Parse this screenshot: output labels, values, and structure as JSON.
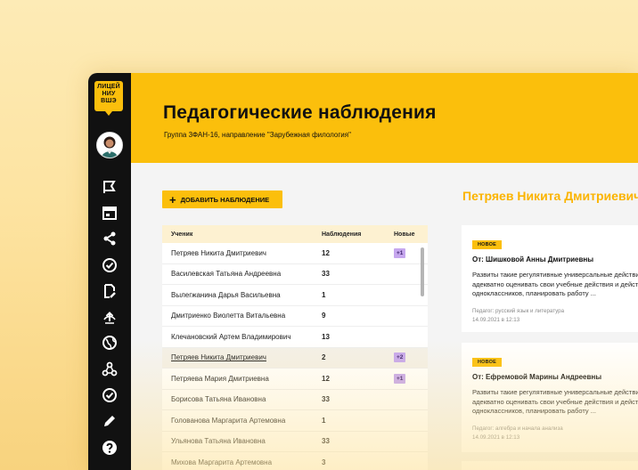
{
  "logo": {
    "line1": "ЛИЦЕЙ",
    "line2": "НИУ",
    "line3": "ВШЭ"
  },
  "sidebar": {
    "icons": [
      "flag-icon",
      "calendar-icon",
      "share-icon",
      "check-circle-icon",
      "edit-document-icon",
      "upload-icon",
      "globe-icon",
      "network-icon",
      "check-circle-icon",
      "pencil-icon",
      "help-icon"
    ]
  },
  "header": {
    "title": "Педагогические наблюдения",
    "subtitle": "Группа 3ФАН-16, направление \"Зарубежная филология\""
  },
  "add_button": {
    "label": "ДОБАВИТЬ НАБЛЮДЕНИЕ"
  },
  "table": {
    "headers": {
      "name": "Ученик",
      "observations": "Наблюдения",
      "new": "Новые"
    },
    "rows": [
      {
        "name": "Петряев Никита Дмитриевич",
        "observations": "12",
        "new": "+1"
      },
      {
        "name": "Василевская Татьяна Андреевна",
        "observations": "33",
        "new": ""
      },
      {
        "name": "Вылегжанина Дарья Васильевна",
        "observations": "1",
        "new": ""
      },
      {
        "name": "Дмитриенко Виолетта Витальевна",
        "observations": "9",
        "new": ""
      },
      {
        "name": "Клечановский Артем Владимирович",
        "observations": "13",
        "new": ""
      },
      {
        "name": "Петряев Никита Дмитриевич",
        "observations": "2",
        "new": "+2"
      },
      {
        "name": "Петряева Мария Дмитриевна",
        "observations": "12",
        "new": "+1"
      },
      {
        "name": "Борисова Татьяна Ивановна",
        "observations": "33",
        "new": ""
      },
      {
        "name": "Голованова Маргарита Артемовна",
        "observations": "1",
        "new": ""
      },
      {
        "name": "Ульянова Татьяна Ивановна",
        "observations": "33",
        "new": ""
      },
      {
        "name": "Михова Маргарита Артемовна",
        "observations": "3",
        "new": ""
      }
    ]
  },
  "detail": {
    "student_name": "Петряев Никита Дмитриевич",
    "cards": [
      {
        "badge": "НОВОЕ",
        "from": "От: Шишковой Анны Дмитриевны",
        "text1": "Развиты такие регулятивные универсальные действия как",
        "text2": "адекватно оценивать свои учебные действия и действия",
        "text3": "одноклассников,  планировать работу ...",
        "teacher": "Педагог: русский язык и литература",
        "date": "14.09.2021 в 12:13"
      },
      {
        "badge": "НОВОЕ",
        "from": "От: Ефремовой Марины Андреевны",
        "text1": "Развиты такие регулятивные универсальные действия как",
        "text2": "адекватно оценивать свои учебные действия и действия",
        "text3": "одноклассников,  планировать работу ...",
        "teacher": "Педагог: алгебра и начала анализа",
        "date": "14.09.2021 в 12:13"
      }
    ]
  },
  "colors": {
    "accent": "#fbbf0c",
    "sidebar": "#111111",
    "badge": "#c6a7ee"
  }
}
